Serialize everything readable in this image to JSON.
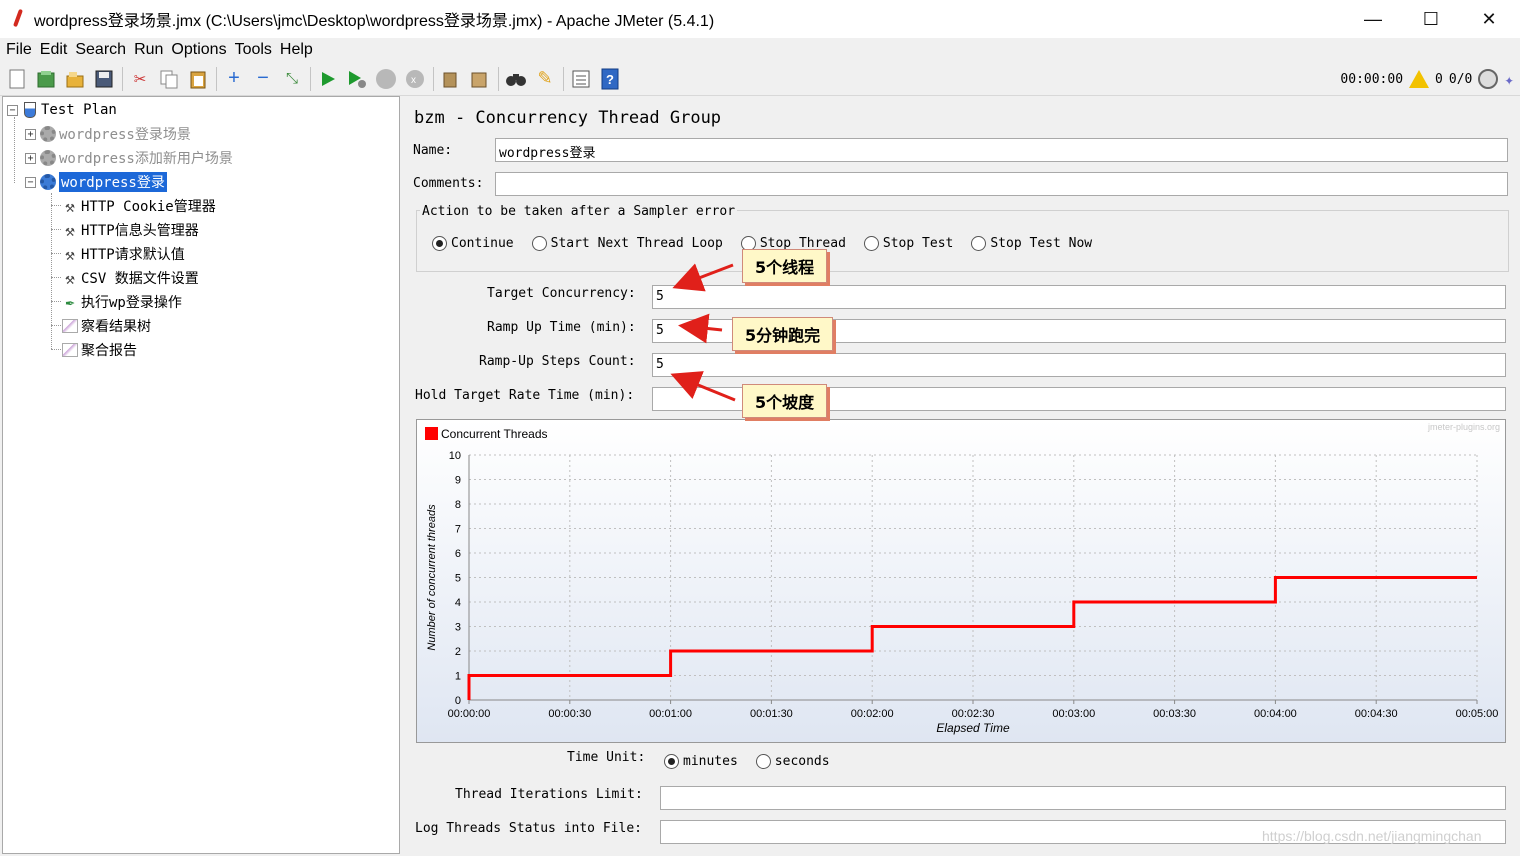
{
  "window": {
    "title": "wordpress登录场景.jmx (C:\\Users\\jmc\\Desktop\\wordpress登录场景.jmx) - Apache JMeter (5.4.1)",
    "minimize": "—",
    "maximize": "☐",
    "close": "✕"
  },
  "menu": [
    "File",
    "Edit",
    "Search",
    "Run",
    "Options",
    "Tools",
    "Help"
  ],
  "toolbar_status": {
    "elapsed": "00:00:00",
    "warnings": "0",
    "threads": "0/0"
  },
  "tree": {
    "root": "Test Plan",
    "group1": "wordpress登录场景",
    "group2": "wordpress添加新用户场景",
    "group3": "wordpress登录",
    "children": [
      "HTTP Cookie管理器",
      "HTTP信息头管理器",
      "HTTP请求默认值",
      "CSV 数据文件设置",
      "执行wp登录操作",
      "察看结果树",
      "聚合报告"
    ]
  },
  "panel": {
    "heading": "bzm - Concurrency Thread Group",
    "name_label": "Name:",
    "name_value": "wordpress登录",
    "comments_label": "Comments:",
    "comments_value": "",
    "action_legend": "Action to be taken after a Sampler error",
    "actions": [
      "Continue",
      "Start Next Thread Loop",
      "Stop Thread",
      "Stop Test",
      "Stop Test Now"
    ],
    "selected_action": "Continue",
    "target_concurrency_label": "Target Concurrency:",
    "target_concurrency_value": "5",
    "ramp_up_time_label": "Ramp Up Time (min):",
    "ramp_up_time_value": "5",
    "ramp_up_steps_label": "Ramp-Up Steps Count:",
    "ramp_up_steps_value": "5",
    "hold_time_label": "Hold Target Rate Time (min):",
    "hold_time_value": "",
    "time_unit_label": "Time Unit:",
    "time_units": [
      "minutes",
      "seconds"
    ],
    "selected_time_unit": "minutes",
    "iterations_label": "Thread Iterations Limit:",
    "iterations_value": "",
    "log_label": "Log Threads Status into File:",
    "log_value": ""
  },
  "callouts": [
    "5个线程",
    "5分钟跑完",
    "5个坡度"
  ],
  "watermark": "https://blog.csdn.net/jiangmingchan",
  "chart_watermark": "jmeter-plugins.org",
  "accent_color": "#ff0000",
  "chart_data": {
    "type": "line",
    "step": true,
    "legend": "Concurrent Threads",
    "xlabel": "Elapsed Time",
    "ylabel": "Number of concurrent threads",
    "x_ticks": [
      "00:00:00",
      "00:00:30",
      "00:01:00",
      "00:01:30",
      "00:02:00",
      "00:02:30",
      "00:03:00",
      "00:03:30",
      "00:04:00",
      "00:04:30",
      "00:05:00"
    ],
    "y_ticks": [
      0,
      1,
      2,
      3,
      4,
      5,
      6,
      7,
      8,
      9,
      10
    ],
    "ylim": [
      0,
      10
    ],
    "xlim_seconds": [
      0,
      300
    ],
    "series": [
      {
        "name": "Concurrent Threads",
        "x_seconds": [
          0,
          60,
          120,
          180,
          240,
          300
        ],
        "values": [
          1,
          2,
          3,
          4,
          5,
          5
        ]
      }
    ]
  }
}
